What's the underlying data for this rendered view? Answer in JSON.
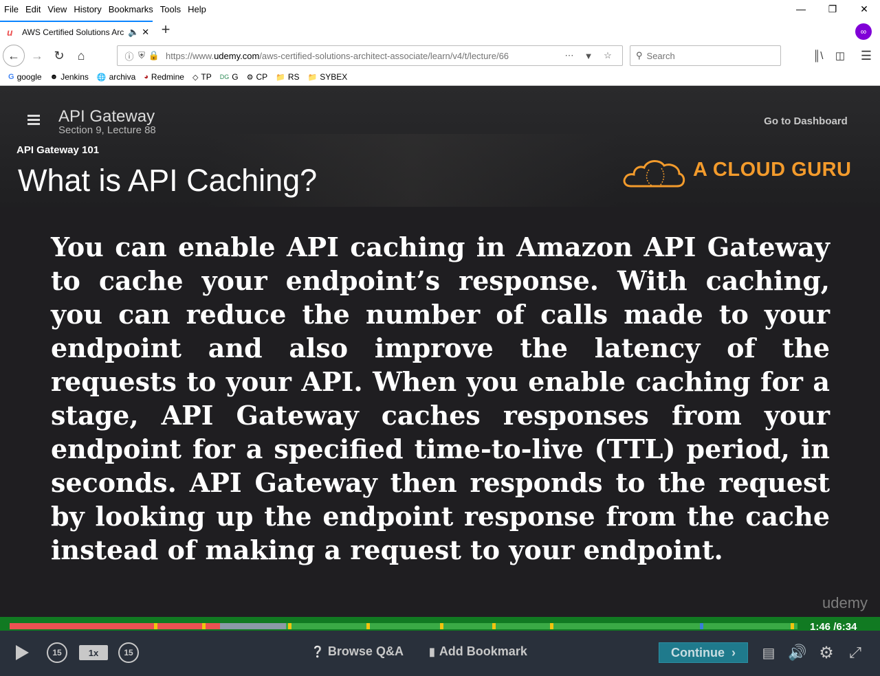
{
  "menubar": {
    "items": [
      "File",
      "Edit",
      "View",
      "History",
      "Bookmarks",
      "Tools",
      "Help"
    ]
  },
  "tab": {
    "title": "AWS Certified Solutions Arc"
  },
  "navbar": {
    "url_prefix": "https://www.",
    "url_domain": "udemy.com",
    "url_path": "/aws-certified-solutions-architect-associate/learn/v4/t/lecture/66",
    "search_placeholder": "Search"
  },
  "bookmarks": [
    "google",
    "Jenkins",
    "archiva",
    "Redmine",
    "TP",
    "G",
    "CP",
    "RS",
    "SYBEX"
  ],
  "player": {
    "lecture_title": "API Gateway",
    "lecture_subtitle": "Section 9, Lecture 88",
    "dashboard_link": "Go to Dashboard"
  },
  "slide": {
    "kicker": "API Gateway 101",
    "title": "What is API Caching?",
    "brand": "A CLOUD GURU",
    "body": "You can enable API caching in Amazon API Gateway to cache your endpoint’s response. With caching, you can reduce the number of calls made to your endpoint and also improve the latency of the requests to your API. When you enable caching for a stage, API Gateway caches responses from your endpoint for a specified time-to-live (TTL) period, in seconds. API Gateway then responds to the request by looking up the endpoint response from the cache instead of making a request to your endpoint."
  },
  "watermark": "udemy",
  "progress": {
    "played_fraction": 0.267,
    "buffered_fraction": 0.351
  },
  "time": "1:46 /6:34",
  "controls": {
    "rewind": "15",
    "speed": "1x",
    "forward": "15",
    "browse_qa": "Browse Q&A",
    "add_bookmark": "Add Bookmark",
    "continue": "Continue"
  },
  "colors": {
    "accent": "#ec5252",
    "brand_orange": "#f39b2c",
    "controls_bg": "#29303b"
  }
}
